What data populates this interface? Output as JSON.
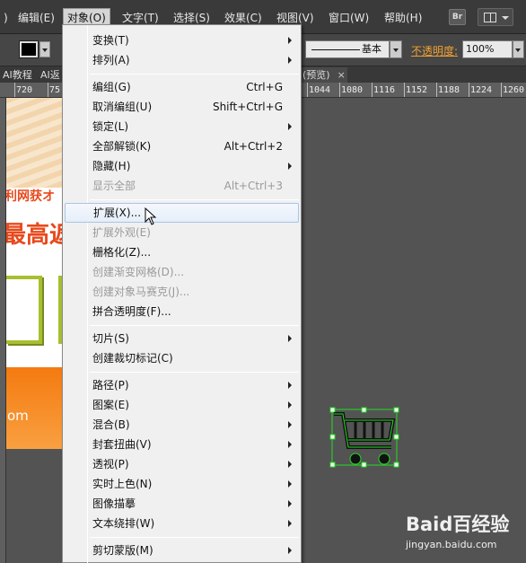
{
  "menubar": {
    "items": [
      {
        "label": ")"
      },
      {
        "label": "编辑(E)"
      },
      {
        "label": "对象(O)"
      },
      {
        "label": "文字(T)"
      },
      {
        "label": "选择(S)"
      },
      {
        "label": "效果(C)"
      },
      {
        "label": "视图(V)"
      },
      {
        "label": "窗口(W)"
      },
      {
        "label": "帮助(H)"
      }
    ],
    "bridge_label": "Br"
  },
  "controlbar": {
    "stroke_profile": "基本",
    "opacity_label": "不透明度:",
    "opacity_value": "100%"
  },
  "tabs": {
    "left": [
      "AI教程",
      "AI返"
    ],
    "right": "(预览)"
  },
  "ruler": {
    "ticks": [
      "720",
      "75",
      "1044",
      "1080",
      "1116",
      "1152",
      "1188",
      "1224",
      "1260"
    ]
  },
  "artboard": {
    "text1": "利网获オ",
    "text2": "最高返",
    "text3": "om"
  },
  "watermark": {
    "main": "Baid百经验",
    "sub": "jingyan.baidu.com"
  },
  "menu": {
    "items": [
      {
        "label": "变换(T)",
        "shortcut": "",
        "submenu": true,
        "disabled": false
      },
      {
        "label": "排列(A)",
        "shortcut": "",
        "submenu": true,
        "disabled": false
      },
      {
        "label": "编组(G)",
        "shortcut": "Ctrl+G",
        "submenu": false,
        "disabled": false
      },
      {
        "label": "取消编组(U)",
        "shortcut": "Shift+Ctrl+G",
        "submenu": false,
        "disabled": false
      },
      {
        "label": "锁定(L)",
        "shortcut": "",
        "submenu": true,
        "disabled": false
      },
      {
        "label": "全部解锁(K)",
        "shortcut": "Alt+Ctrl+2",
        "submenu": false,
        "disabled": false
      },
      {
        "label": "隐藏(H)",
        "shortcut": "",
        "submenu": true,
        "disabled": false
      },
      {
        "label": "显示全部",
        "shortcut": "Alt+Ctrl+3",
        "submenu": false,
        "disabled": true
      },
      {
        "label": "扩展(X)...",
        "shortcut": "",
        "submenu": false,
        "disabled": false,
        "hover": true
      },
      {
        "label": "扩展外观(E)",
        "shortcut": "",
        "submenu": false,
        "disabled": true
      },
      {
        "label": "栅格化(Z)...",
        "shortcut": "",
        "submenu": false,
        "disabled": false
      },
      {
        "label": "创建渐变网格(D)...",
        "shortcut": "",
        "submenu": false,
        "disabled": true
      },
      {
        "label": "创建对象马赛克(J)...",
        "shortcut": "",
        "submenu": false,
        "disabled": true
      },
      {
        "label": "拼合透明度(F)...",
        "shortcut": "",
        "submenu": false,
        "disabled": false
      },
      {
        "label": "切片(S)",
        "shortcut": "",
        "submenu": true,
        "disabled": false
      },
      {
        "label": "创建裁切标记(C)",
        "shortcut": "",
        "submenu": false,
        "disabled": false
      },
      {
        "label": "路径(P)",
        "shortcut": "",
        "submenu": true,
        "disabled": false
      },
      {
        "label": "图案(E)",
        "shortcut": "",
        "submenu": true,
        "disabled": false
      },
      {
        "label": "混合(B)",
        "shortcut": "",
        "submenu": true,
        "disabled": false
      },
      {
        "label": "封套扭曲(V)",
        "shortcut": "",
        "submenu": true,
        "disabled": false
      },
      {
        "label": "透视(P)",
        "shortcut": "",
        "submenu": true,
        "disabled": false
      },
      {
        "label": "实时上色(N)",
        "shortcut": "",
        "submenu": true,
        "disabled": false
      },
      {
        "label": "图像描摹",
        "shortcut": "",
        "submenu": true,
        "disabled": false
      },
      {
        "label": "文本绕排(W)",
        "shortcut": "",
        "submenu": true,
        "disabled": false
      },
      {
        "label": "剪切蒙版(M)",
        "shortcut": "",
        "submenu": true,
        "disabled": false
      }
    ]
  },
  "colors": {
    "accent_orange": "#f0a030",
    "selection_green": "#22dd22"
  }
}
